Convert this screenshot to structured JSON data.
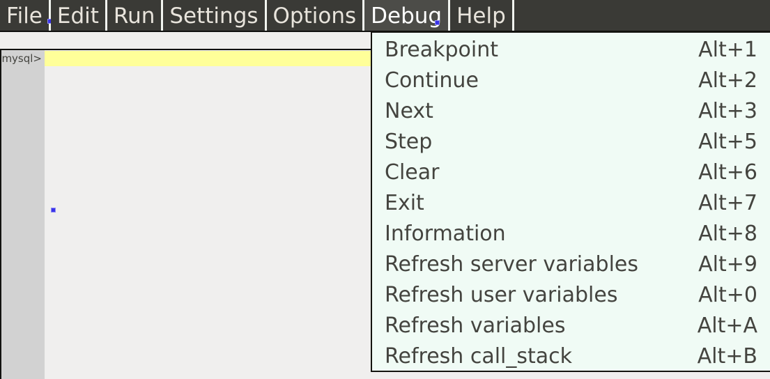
{
  "menubar": {
    "items": [
      {
        "label": "File"
      },
      {
        "label": "Edit"
      },
      {
        "label": "Run"
      },
      {
        "label": "Settings"
      },
      {
        "label": "Options"
      },
      {
        "label": "Debug"
      },
      {
        "label": "Help"
      }
    ],
    "active_item": "Debug"
  },
  "editor": {
    "prompt": "mysql>"
  },
  "debug_menu": {
    "title": "Debug",
    "items": [
      {
        "label": "Breakpoint",
        "shortcut": "Alt+1"
      },
      {
        "label": "Continue",
        "shortcut": "Alt+2"
      },
      {
        "label": "Next",
        "shortcut": "Alt+3"
      },
      {
        "label": "Step",
        "shortcut": "Alt+5"
      },
      {
        "label": "Clear",
        "shortcut": "Alt+6"
      },
      {
        "label": "Exit",
        "shortcut": "Alt+7"
      },
      {
        "label": "Information",
        "shortcut": "Alt+8"
      },
      {
        "label": "Refresh server variables",
        "shortcut": "Alt+9"
      },
      {
        "label": "Refresh user variables",
        "shortcut": "Alt+0"
      },
      {
        "label": "Refresh variables",
        "shortcut": "Alt+A"
      },
      {
        "label": "Refresh call_stack",
        "shortcut": "Alt+B"
      }
    ]
  },
  "colors": {
    "menubar_bg": "#3a3a36",
    "menubar_active_bg": "#4c4c48",
    "menubar_text": "#e8e4dc",
    "dropdown_bg": "#f0fbf5",
    "dropdown_text": "#44443f",
    "gutter_bg": "#d2d2d2",
    "editor_bg": "#f0efee",
    "highlight_row": "#ffff99",
    "marker_blue": "#3a34e8"
  }
}
